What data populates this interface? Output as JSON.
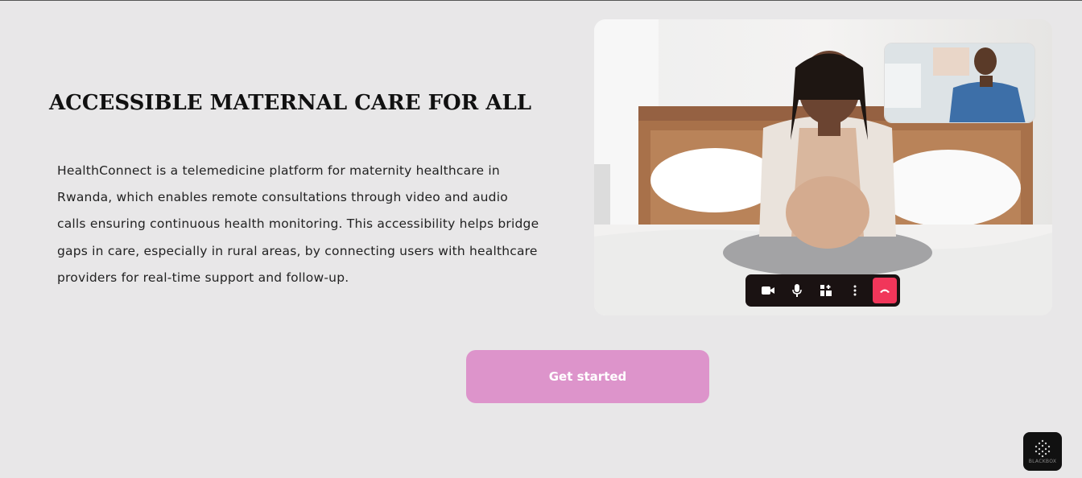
{
  "hero": {
    "headline": "ACCESSIBLE MATERNAL CARE FOR ALL",
    "description": "HealthConnect  is a telemedicine platform for maternity healthcare in Rwanda, which enables remote consultations through video and audio calls ensuring continuous health monitoring. This accessibility helps bridge gaps in care, especially in rural areas, by connecting users with healthcare providers for real-time support and follow-up."
  },
  "video_call": {
    "controls": [
      "video-camera-icon",
      "microphone-icon",
      "add-participant-icon",
      "more-options-icon",
      "end-call-icon"
    ],
    "end_call_color": "#f1365a"
  },
  "cta": {
    "label": "Get started",
    "color": "#dd94cb"
  },
  "badge": {
    "label": "BLACKBOX"
  },
  "colors": {
    "background": "#e8e7e8",
    "text": "#111111"
  }
}
